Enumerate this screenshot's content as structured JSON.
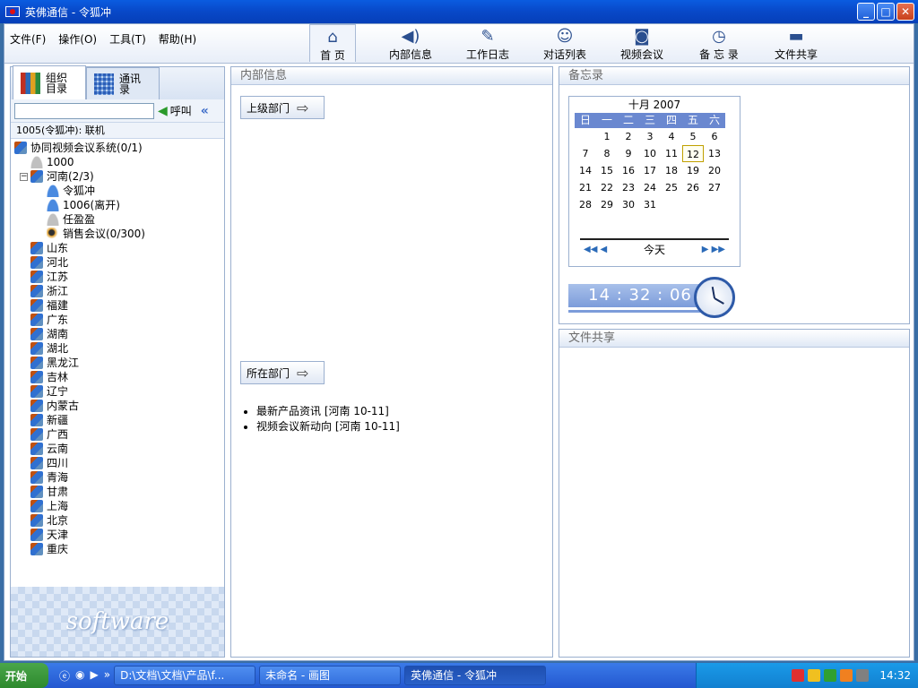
{
  "window": {
    "title": "英佛通信 - 令狐冲"
  },
  "menu": [
    {
      "label": "文件(F)"
    },
    {
      "label": "操作(O)"
    },
    {
      "label": "工具(T)"
    },
    {
      "label": "帮助(H)"
    }
  ],
  "toolbar": [
    {
      "label": "首 页",
      "icon": "house-icon"
    },
    {
      "label": "内部信息",
      "icon": "megaphone-icon"
    },
    {
      "label": "工作日志",
      "icon": "pen-icon"
    },
    {
      "label": "对话列表",
      "icon": "chat-icon"
    },
    {
      "label": "视频会议",
      "icon": "camera-icon"
    },
    {
      "label": "备 忘 录",
      "icon": "clock-book-icon"
    },
    {
      "label": "文件共享",
      "icon": "folder-share-icon"
    }
  ],
  "left": {
    "tabs": [
      {
        "label": "组织\n目录",
        "icon": "books-icon"
      },
      {
        "label": "通讯\n录",
        "icon": "grid-icon"
      }
    ],
    "search_value": "",
    "call_label": "呼叫",
    "status": "1005(令狐冲): 联机",
    "tree": [
      {
        "label": "协同视频会议系统(0/1)",
        "type": "group",
        "indent": 0
      },
      {
        "label": "1000",
        "type": "person-offline",
        "indent": 1
      },
      {
        "label": "河南(2/3)",
        "type": "group",
        "indent": 1,
        "expanded": true
      },
      {
        "label": "令狐冲",
        "type": "person",
        "indent": 2
      },
      {
        "label": "1006(离开)",
        "type": "person",
        "indent": 2
      },
      {
        "label": "任盈盈",
        "type": "person-offline",
        "indent": 2
      },
      {
        "label": "销售会议(0/300)",
        "type": "meeting",
        "indent": 2
      },
      {
        "label": "山东",
        "type": "group",
        "indent": 1
      },
      {
        "label": "河北",
        "type": "group",
        "indent": 1
      },
      {
        "label": "江苏",
        "type": "group",
        "indent": 1
      },
      {
        "label": "浙江",
        "type": "group",
        "indent": 1
      },
      {
        "label": "福建",
        "type": "group",
        "indent": 1
      },
      {
        "label": "广东",
        "type": "group",
        "indent": 1
      },
      {
        "label": "湖南",
        "type": "group",
        "indent": 1
      },
      {
        "label": "湖北",
        "type": "group",
        "indent": 1
      },
      {
        "label": "黑龙江",
        "type": "group",
        "indent": 1
      },
      {
        "label": "吉林",
        "type": "group",
        "indent": 1
      },
      {
        "label": "辽宁",
        "type": "group",
        "indent": 1
      },
      {
        "label": "内蒙古",
        "type": "group",
        "indent": 1
      },
      {
        "label": "新疆",
        "type": "group",
        "indent": 1
      },
      {
        "label": "广西",
        "type": "group",
        "indent": 1
      },
      {
        "label": "云南",
        "type": "group",
        "indent": 1
      },
      {
        "label": "四川",
        "type": "group",
        "indent": 1
      },
      {
        "label": "青海",
        "type": "group",
        "indent": 1
      },
      {
        "label": "甘肃",
        "type": "group",
        "indent": 1
      },
      {
        "label": "上海",
        "type": "group",
        "indent": 1
      },
      {
        "label": "北京",
        "type": "group",
        "indent": 1
      },
      {
        "label": "天津",
        "type": "group",
        "indent": 1
      },
      {
        "label": "重庆",
        "type": "group",
        "indent": 1
      }
    ],
    "logo_text": "software"
  },
  "middle": {
    "title": "内部信息",
    "upper_dept_label": "上级部门",
    "current_dept_label": "所在部门",
    "news": [
      "最新产品资讯 [河南 10-11]",
      "视频会议新动向 [河南 10-11]"
    ]
  },
  "memo": {
    "title": "备忘录",
    "month_title": "十月 2007",
    "weekdays": [
      "日",
      "一",
      "二",
      "三",
      "四",
      "五",
      "六"
    ],
    "weeks": [
      [
        "",
        "1",
        "2",
        "3",
        "4",
        "5",
        "6"
      ],
      [
        "7",
        "8",
        "9",
        "10",
        "11",
        "12",
        "13"
      ],
      [
        "14",
        "15",
        "16",
        "17",
        "18",
        "19",
        "20"
      ],
      [
        "21",
        "22",
        "23",
        "24",
        "25",
        "26",
        "27"
      ],
      [
        "28",
        "29",
        "30",
        "31",
        "",
        "",
        ""
      ]
    ],
    "today": "12",
    "today_label": "今天",
    "time": "14 : 32 : 06"
  },
  "share": {
    "title": "文件共享"
  },
  "taskbar": {
    "start_label": "开始",
    "items": [
      {
        "label": "D:\\文档\\文档\\产品\\f..."
      },
      {
        "label": "未命名 - 画图"
      },
      {
        "label": "英佛通信 - 令狐冲",
        "active": true
      }
    ],
    "clock": "14:32"
  },
  "colors": {
    "accent": "#3a6ac8",
    "titlebar": "#0a5ce0",
    "panel_border": "#9bb0cf"
  }
}
